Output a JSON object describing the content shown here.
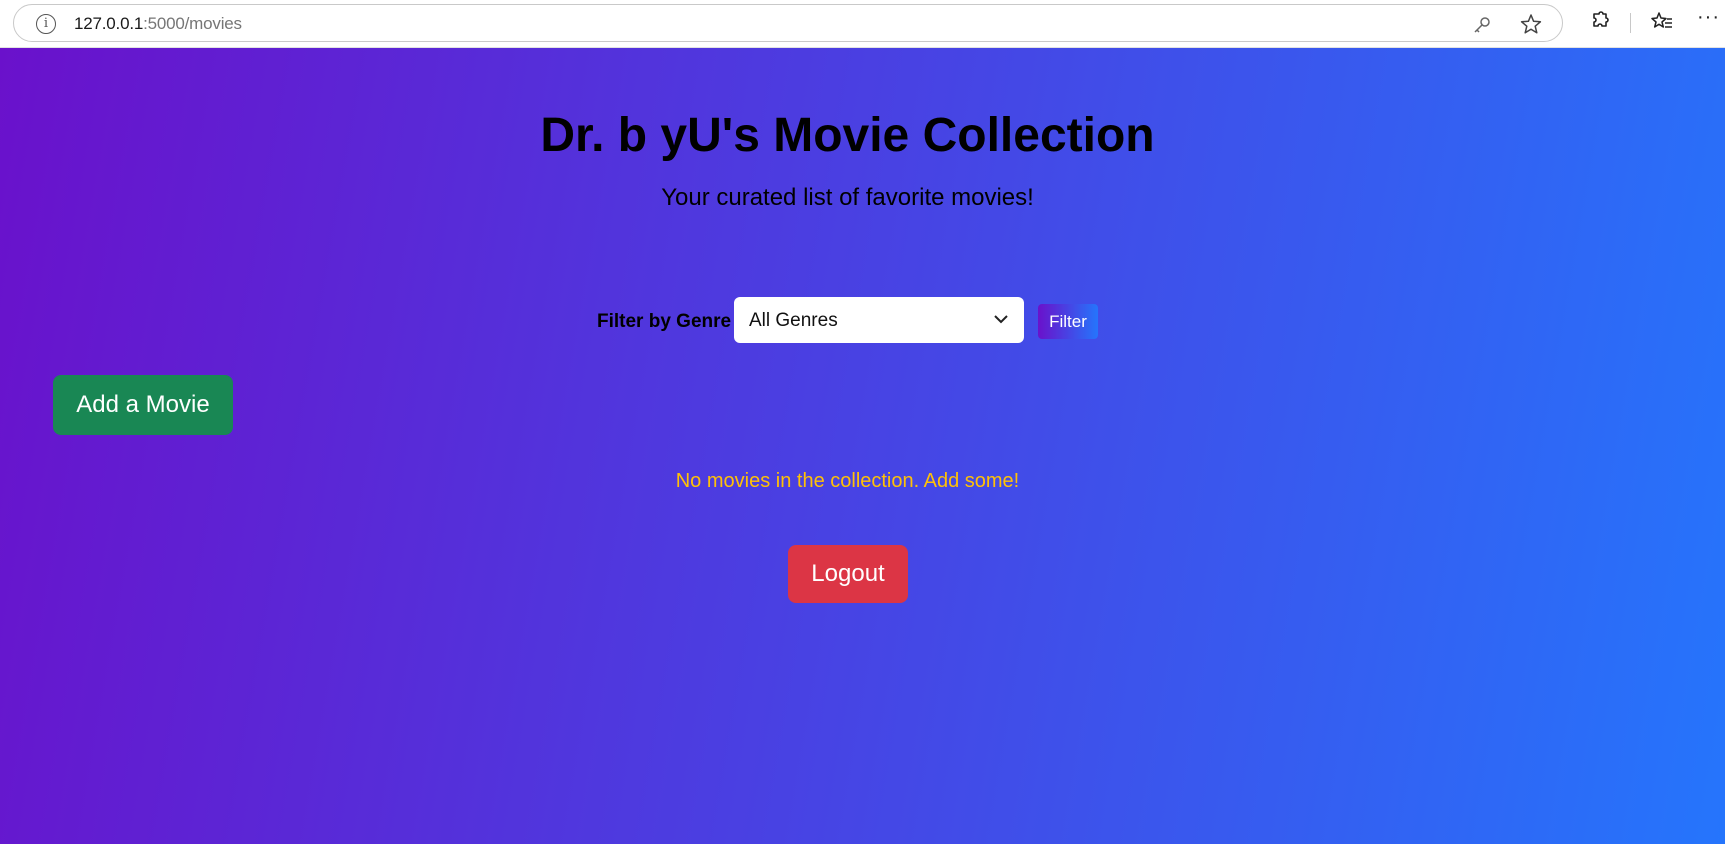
{
  "browser": {
    "url_host": "127.0.0.1",
    "url_path": ":5000/movies",
    "icons": [
      "info-icon",
      "key-icon",
      "star-icon",
      "extensions-icon",
      "favorites-icon",
      "more-icon"
    ]
  },
  "header": {
    "title": "Dr. b yU's Movie Collection",
    "subtitle": "Your curated list of favorite movies!"
  },
  "filter": {
    "label": "Filter by Genre",
    "selected": "All Genres",
    "button_label": "Filter"
  },
  "actions": {
    "add_label": "Add a Movie",
    "logout_label": "Logout"
  },
  "collection": {
    "empty_message": "No movies in the collection. Add some!"
  },
  "colors": {
    "gradient_start": "#6a11cb",
    "gradient_end": "#2575fc",
    "add_button": "#198754",
    "logout_button": "#dc3545",
    "empty_message": "#ffc107"
  }
}
